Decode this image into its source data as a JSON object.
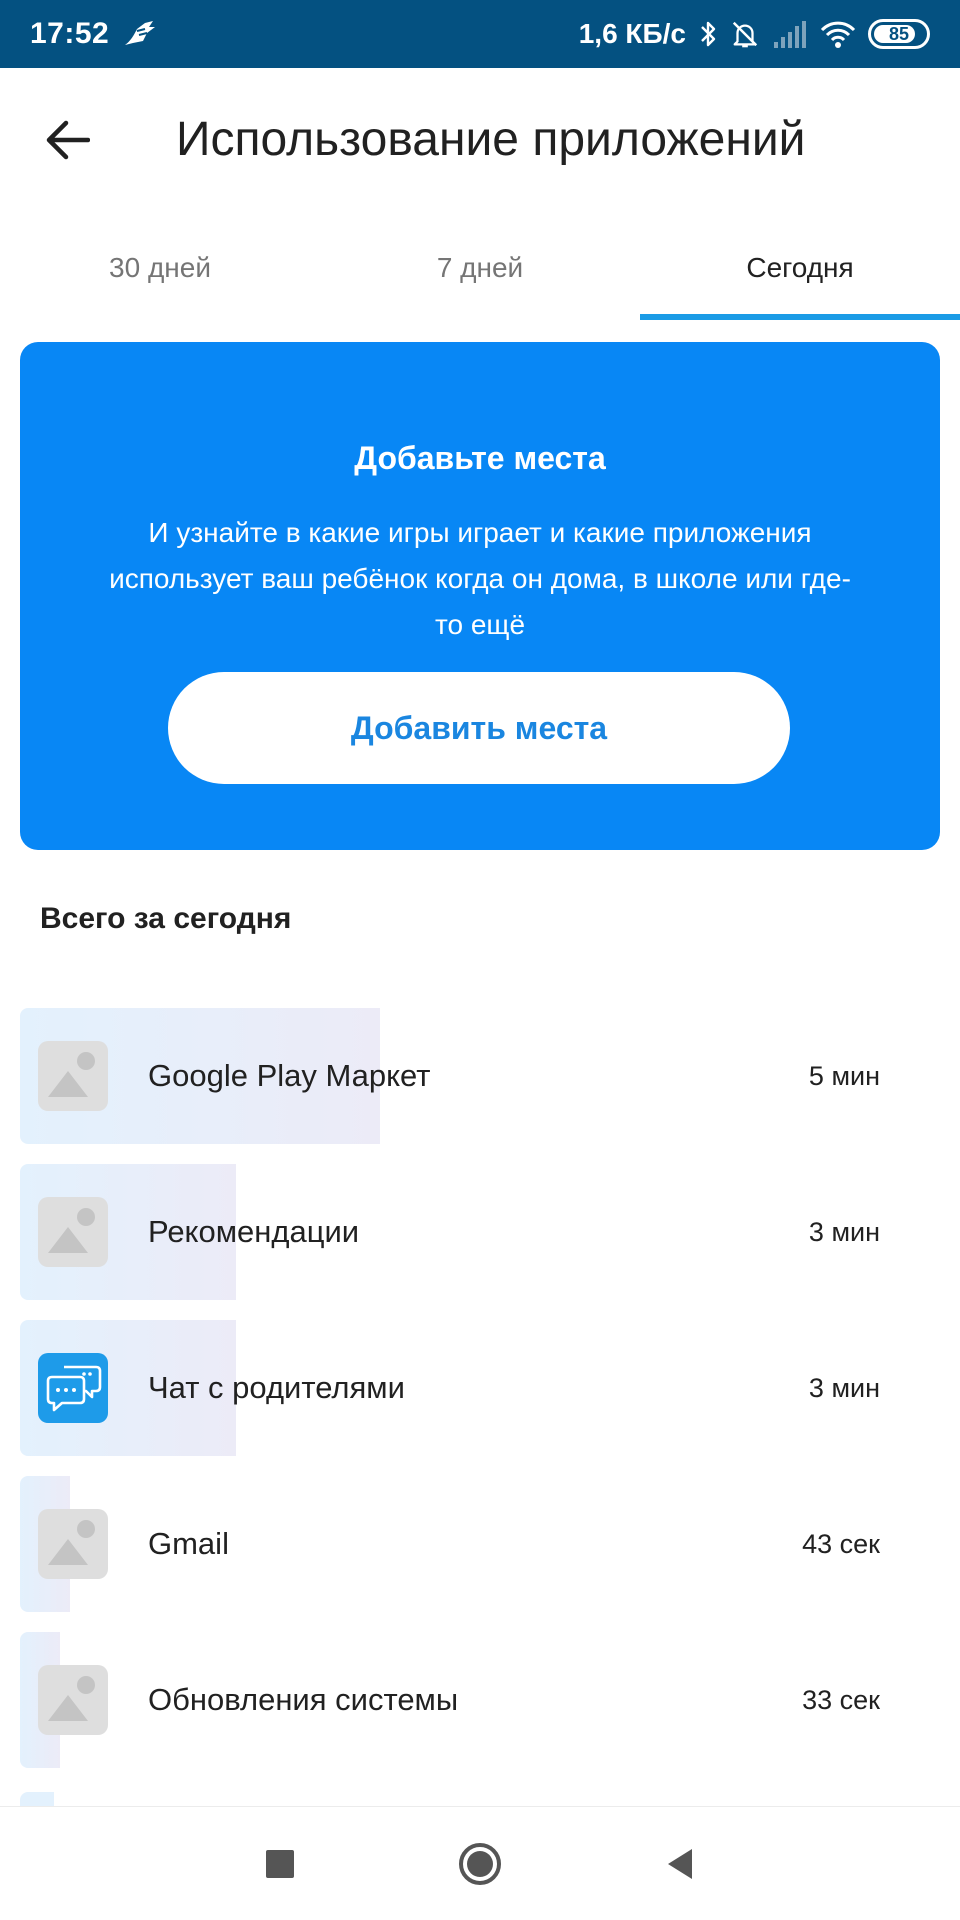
{
  "status_bar": {
    "time": "17:52",
    "speed": "1,6 КБ/с",
    "battery": "85",
    "icons": [
      "bird-notification-icon",
      "bluetooth-icon",
      "alarm-off-icon",
      "signal-icon",
      "wifi-icon",
      "battery-icon"
    ]
  },
  "header": {
    "title": "Использование приложений",
    "back_icon": "arrow-left-icon"
  },
  "tabs": [
    {
      "label": "30 дней",
      "active": false
    },
    {
      "label": "7 дней",
      "active": false
    },
    {
      "label": "Сегодня",
      "active": true
    }
  ],
  "banner": {
    "title": "Добавьте места",
    "text": "И узнайте в какие игры играет и какие приложения использует ваш ребёнок когда он дома, в школе или где-то ещё",
    "button_label": "Добавить места",
    "background": "#0887f5"
  },
  "section_title": "Всего за сегодня",
  "apps": [
    {
      "name": "Google Play Маркет",
      "time": "5 мин",
      "icon": "placeholder-image-icon",
      "usage_fraction": 1.0
    },
    {
      "name": "Рекомендации",
      "time": "3 мин",
      "icon": "placeholder-image-icon",
      "usage_fraction": 0.6
    },
    {
      "name": "Чат с родителями",
      "time": "3 мин",
      "icon": "chat-bubbles-icon",
      "usage_fraction": 0.6
    },
    {
      "name": "Gmail",
      "time": "43 сек",
      "icon": "placeholder-image-icon",
      "usage_fraction": 0.14
    },
    {
      "name": "Обновления системы",
      "time": "33 сек",
      "icon": "placeholder-image-icon",
      "usage_fraction": 0.11
    }
  ],
  "nav": {
    "icons": [
      "recents-square-icon",
      "home-circle-icon",
      "back-triangle-icon"
    ]
  },
  "colors": {
    "status_bar": "#045181",
    "accent": "#1a9be6",
    "button_text": "#1a86e0"
  }
}
